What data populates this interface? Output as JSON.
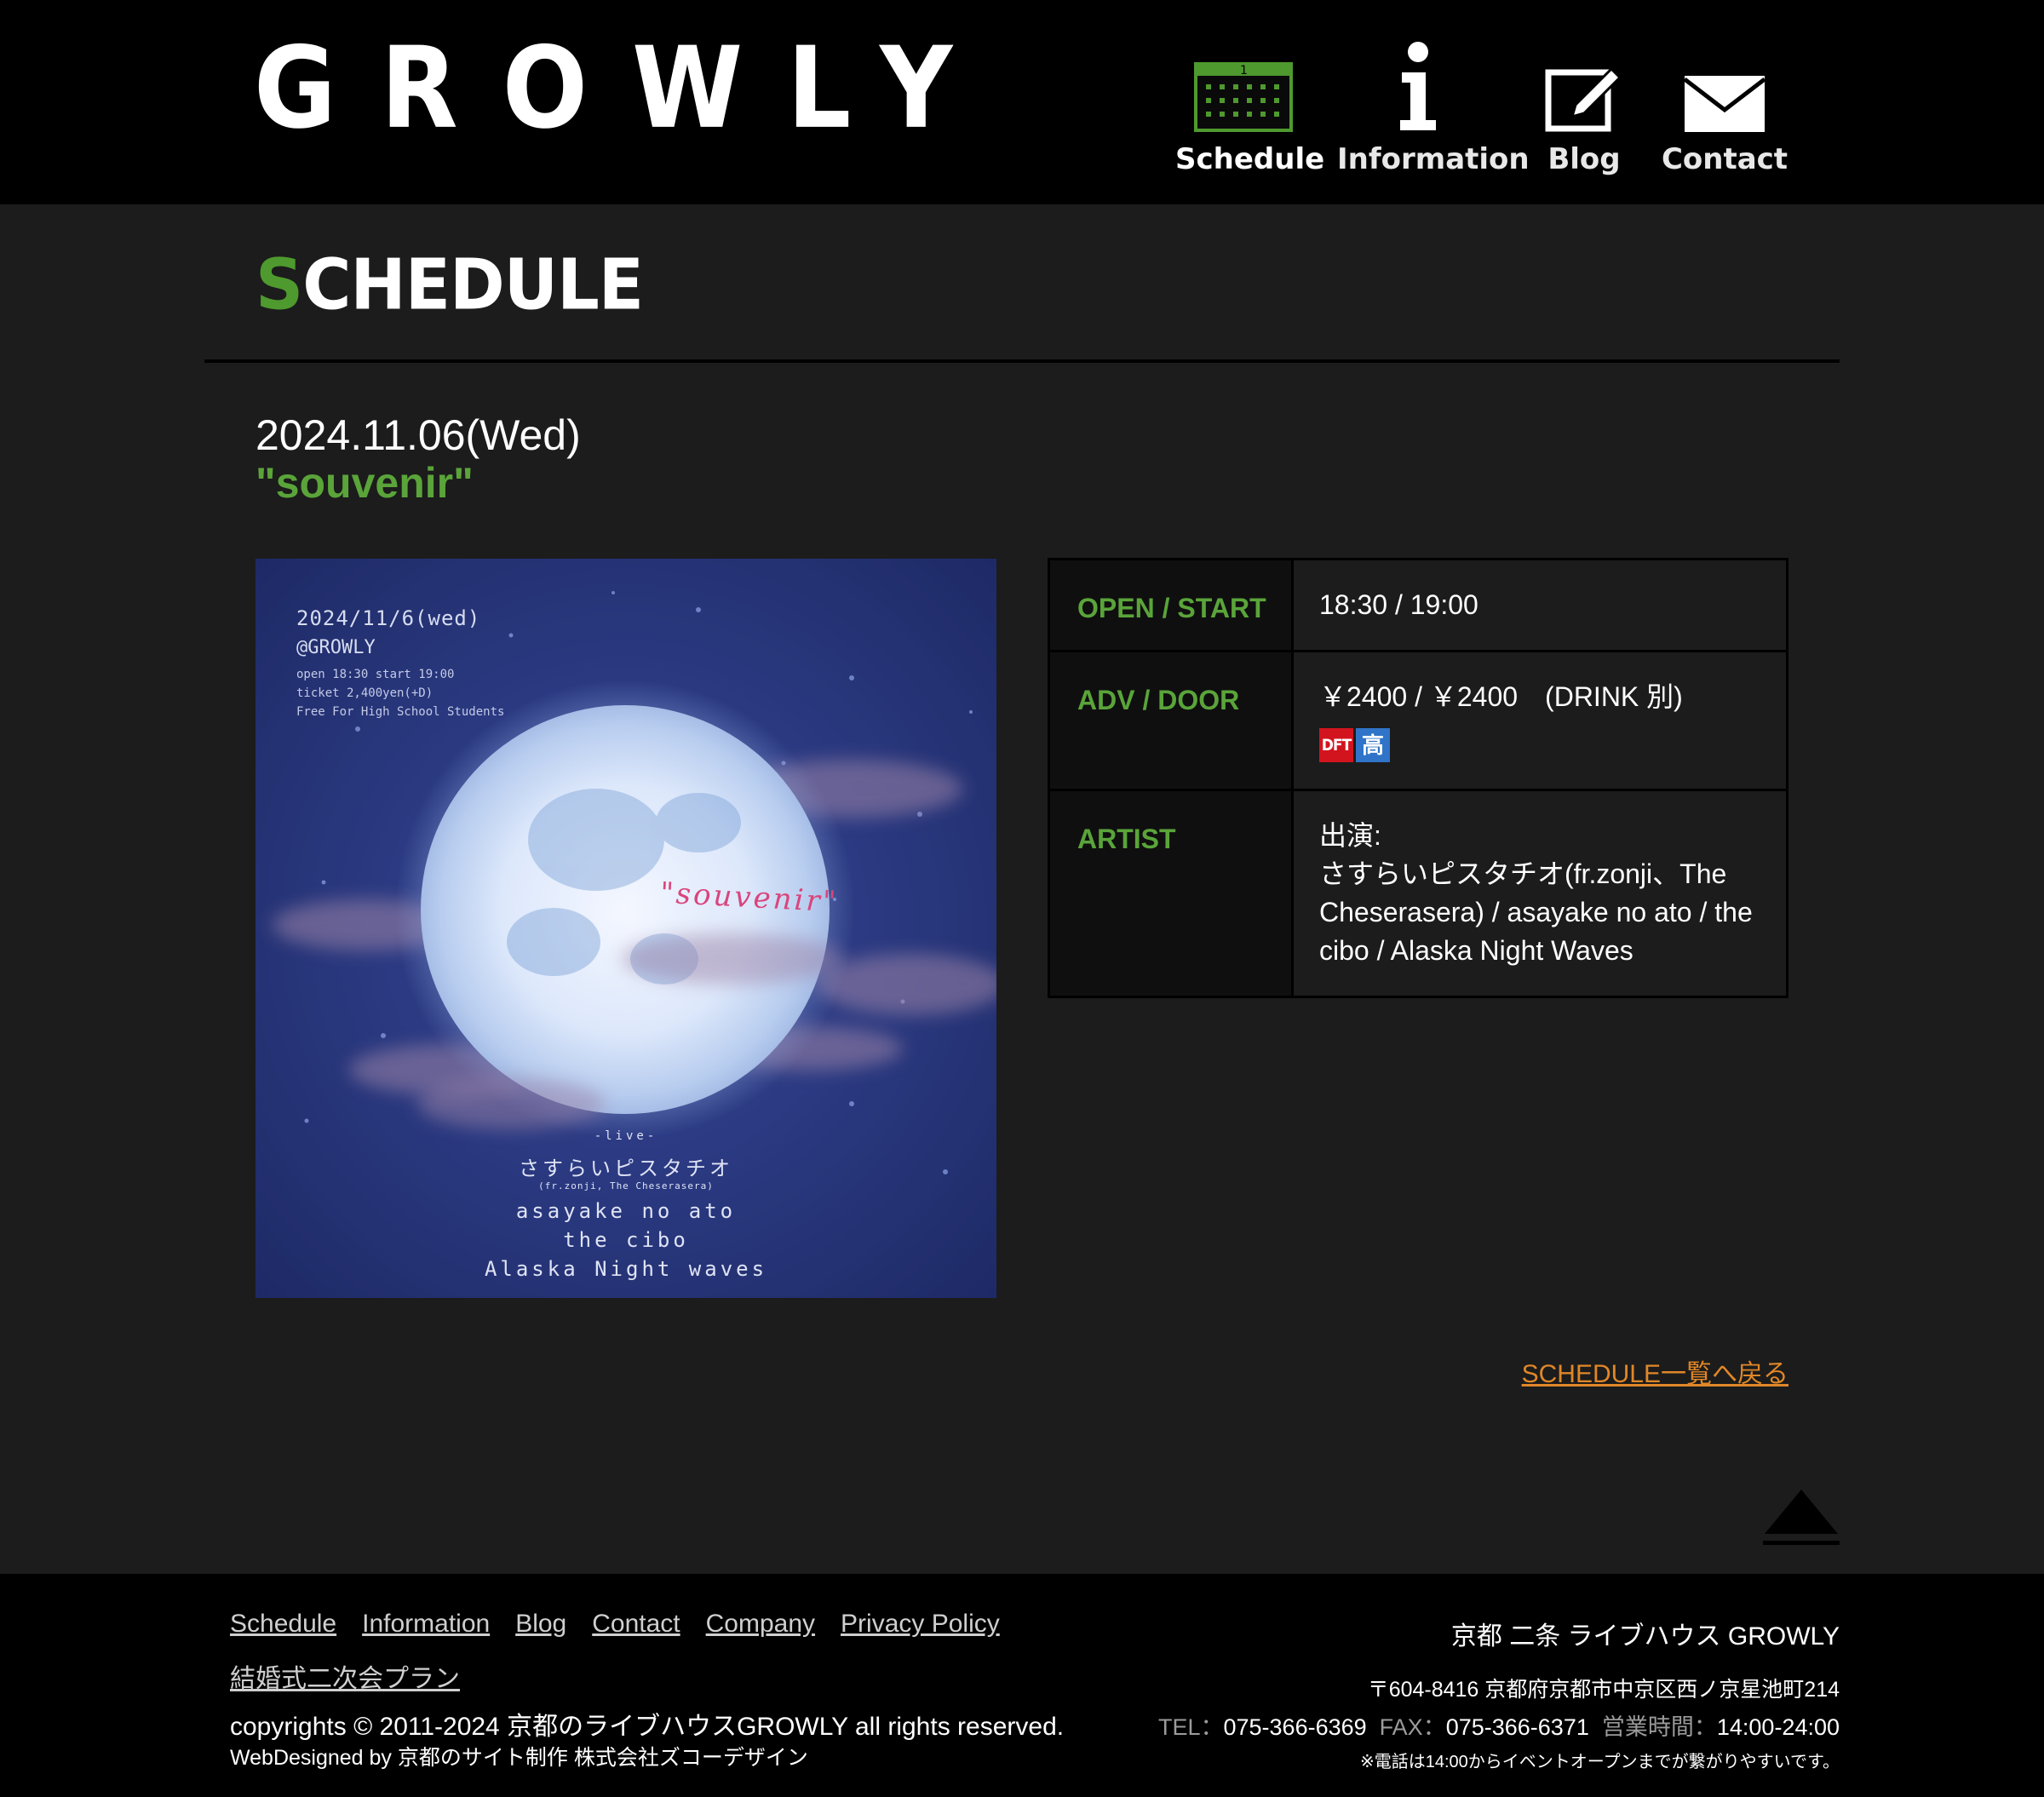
{
  "header": {
    "logo_text": "GROWLY",
    "nav": [
      {
        "label": "Schedule",
        "icon": "calendar-icon"
      },
      {
        "label": "Information",
        "icon": "info-icon"
      },
      {
        "label": "Blog",
        "icon": "edit-icon"
      },
      {
        "label": "Contact",
        "icon": "mail-icon"
      }
    ]
  },
  "page": {
    "section_title_first": "S",
    "section_title_rest": "CHEDULE",
    "event_date": "2024.11.06(Wed)",
    "event_title": "\"souvenir\""
  },
  "flyer": {
    "date": "2024/11/6(wed)",
    "venue": "@GROWLY",
    "line1": "open 18:30 start 19:00",
    "line2": "ticket 2,400yen(+D)",
    "line3": "Free For High School Students",
    "title": "\"souvenir\"",
    "live": "-live-",
    "act1": "さすらいピスタチオ",
    "act1_sub": "(fr.zonji, The Cheserasera)",
    "act2": "asayake no ato",
    "act3": "the cibo",
    "act4": "Alaska Night waves"
  },
  "info": {
    "open_label": "OPEN / START",
    "open_value": "18:30 / 19:00",
    "adv_label": "ADV / DOOR",
    "adv_value": "￥2400 / ￥2400　(DRINK 別)",
    "badge_dft": "DFT",
    "badge_hs": "高",
    "artist_label": "ARTIST",
    "artist_intro": "出演:",
    "artist_value": "さすらいピスタチオ(fr.zonji、The Cheserasera) / asayake no ato / the cibo / Alaska Night Waves"
  },
  "back_link": "SCHEDULE一覧へ戻る",
  "footer": {
    "links": [
      "Schedule",
      "Information",
      "Blog",
      "Contact",
      "Company",
      "Privacy Policy"
    ],
    "link2": "結婚式二次会プラン",
    "copyright": "copyrights © 2011-2024 京都のライブハウスGROWLY all rights reserved.",
    "webdesign": "WebDesigned by 京都のサイト制作 株式会社ズコーデザイン",
    "venue_name": "京都 二条 ライブハウス GROWLY",
    "address": "〒604-8416 京都府京都市中京区西ノ京星池町214",
    "tel_label": "TEL：",
    "tel": "075-366-6369",
    "fax_label": "FAX：",
    "fax": "075-366-6371",
    "hours_label": "営業時間：",
    "hours": "14:00-24:00",
    "note": "※電話は14:00からイベントオープンまでが繋がりやすいです。"
  },
  "colors": {
    "accent_green": "#5aa43a",
    "link_orange": "#e08728",
    "header_bg": "#000000",
    "body_bg": "#1c1c1c"
  }
}
